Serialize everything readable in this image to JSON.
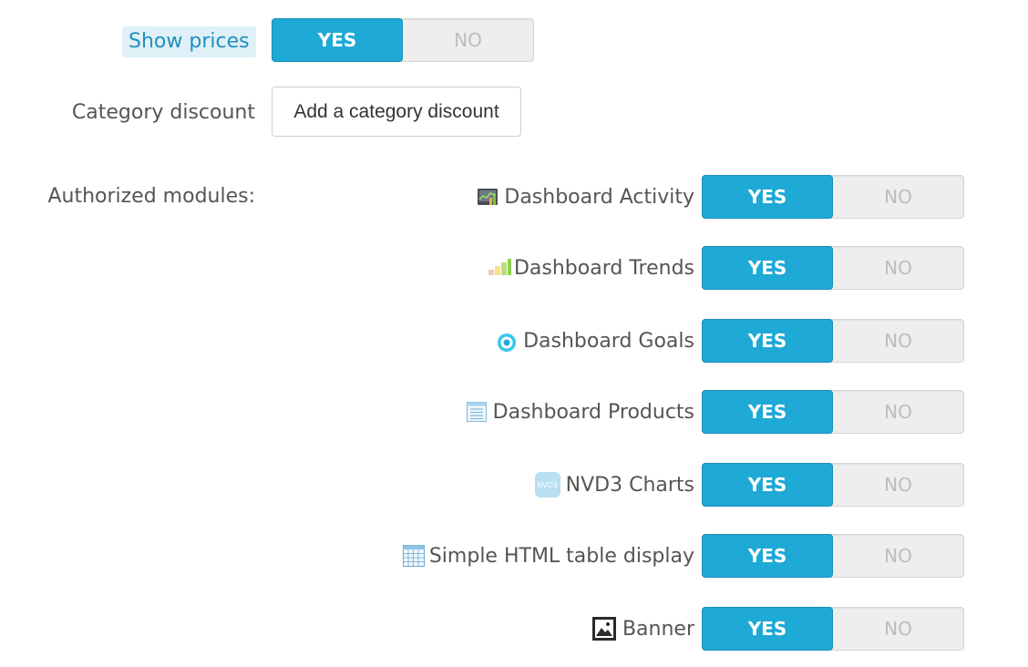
{
  "show_prices": {
    "label": "Show prices",
    "yes_label": "YES",
    "no_label": "NO",
    "value": "YES"
  },
  "category_discount": {
    "label": "Category discount",
    "button_label": "Add a category discount"
  },
  "authorized_modules": {
    "label": "Authorized modules:",
    "items": [
      {
        "name": "Dashboard Activity",
        "icon": "dashboard-activity-icon",
        "yes_label": "YES",
        "no_label": "NO",
        "value": "YES"
      },
      {
        "name": "Dashboard Trends",
        "icon": "dashboard-trends-icon",
        "yes_label": "YES",
        "no_label": "NO",
        "value": "YES"
      },
      {
        "name": "Dashboard Goals",
        "icon": "dashboard-goals-icon",
        "yes_label": "YES",
        "no_label": "NO",
        "value": "YES"
      },
      {
        "name": "Dashboard Products",
        "icon": "dashboard-products-icon",
        "yes_label": "YES",
        "no_label": "NO",
        "value": "YES"
      },
      {
        "name": "NVD3 Charts",
        "icon": "nvd3-charts-icon",
        "icon_text": "NVD3",
        "yes_label": "YES",
        "no_label": "NO",
        "value": "YES"
      },
      {
        "name": "Simple HTML table display",
        "icon": "html-table-icon",
        "yes_label": "YES",
        "no_label": "NO",
        "value": "YES"
      },
      {
        "name": "Banner",
        "icon": "banner-image-icon",
        "yes_label": "YES",
        "no_label": "NO",
        "value": "YES"
      }
    ]
  },
  "colors": {
    "accent": "#1ea9d6",
    "label_highlight_bg": "#dff0f7",
    "label_highlight_text": "#1f8fc1",
    "toggle_off_bg": "#eeeeee"
  }
}
